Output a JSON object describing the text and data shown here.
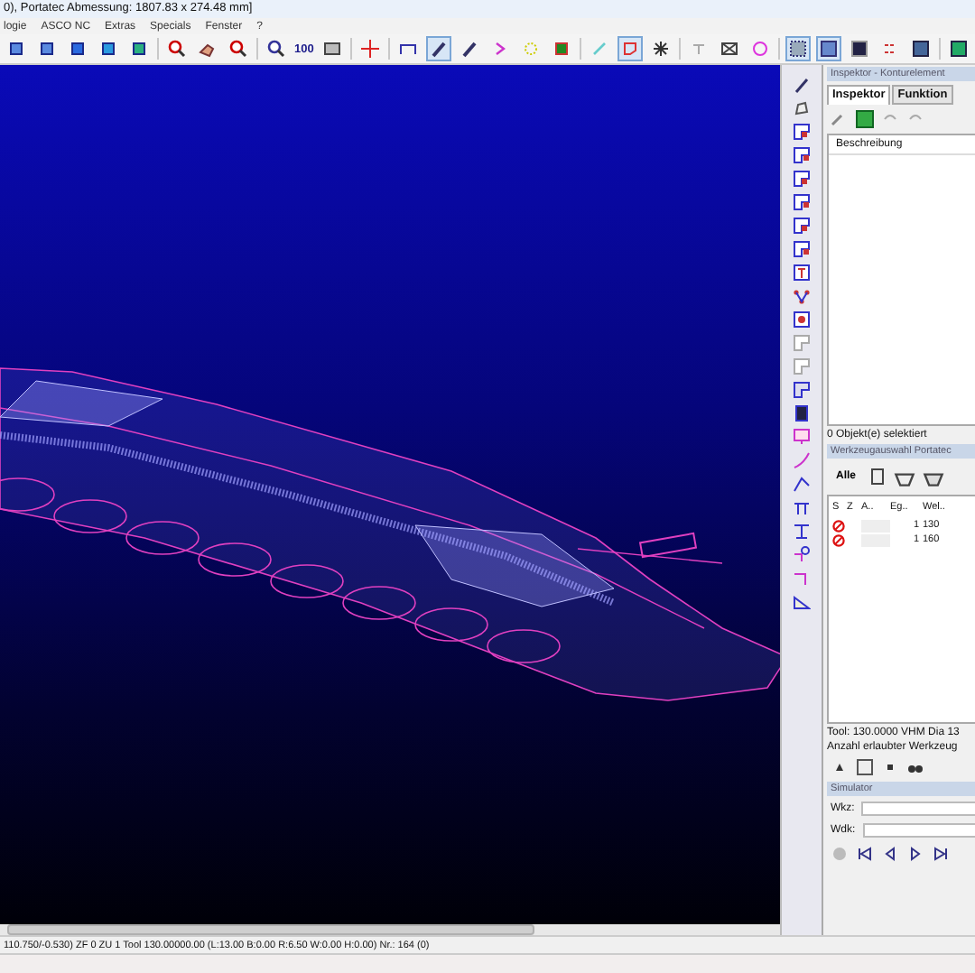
{
  "window": {
    "title": "0), Portatec  Abmessung: 1807.83 x 274.48 mm]"
  },
  "menu": [
    "logie",
    "ASCO NC",
    "Extras",
    "Specials",
    "Fenster",
    "?"
  ],
  "toolbar": {
    "zoom_label": "100"
  },
  "inspector": {
    "title": "Inspektor - Konturelement",
    "tabs": [
      {
        "label": "Inspektor",
        "selected": true
      },
      {
        "label": "Funktion",
        "selected": false
      }
    ],
    "column": "Beschreibung",
    "status": "0 Objekt(e) selektiert"
  },
  "tool_selection": {
    "title": "Werkzeugauswahl Portatec",
    "all_button": "Alle",
    "columns": [
      "S",
      "Z",
      "A..",
      "Eg..",
      "Wel.."
    ],
    "rows": [
      {
        "eg": "1",
        "wel": "130"
      },
      {
        "eg": "1",
        "wel": "160"
      }
    ],
    "tool_info": "Tool: 130.0000 VHM Dia 13",
    "count_label": "Anzahl erlaubter Werkzeug"
  },
  "simulator": {
    "title": "Simulator",
    "fields": [
      "Wkz:",
      "Wdk:"
    ]
  },
  "status_bar": "110.750/-0.530)  ZF 0 ZU 1 Tool 130.00000.00 (L:13.00 B:0.00 R:6.50 W:0.00 H:0.00)   Nr.: 164 (0)"
}
